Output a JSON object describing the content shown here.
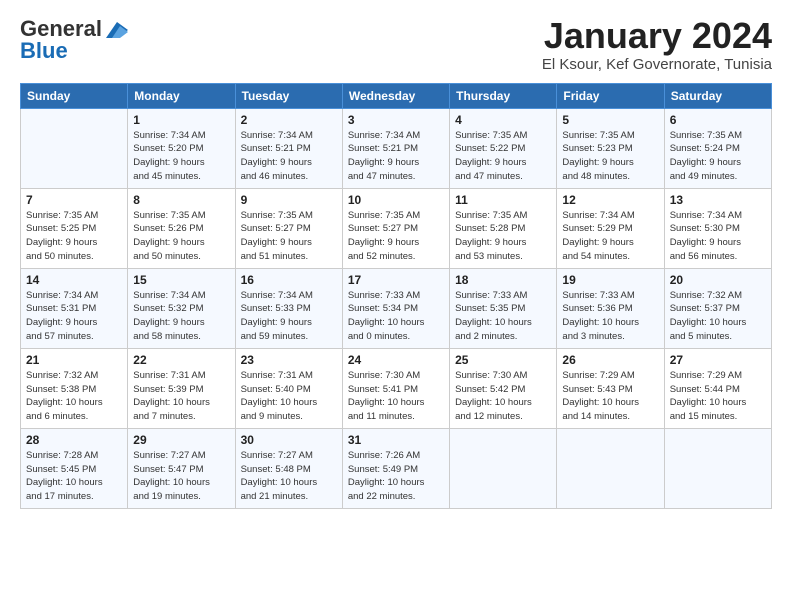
{
  "header": {
    "logo_general": "General",
    "logo_blue": "Blue",
    "month_title": "January 2024",
    "subtitle": "El Ksour, Kef Governorate, Tunisia"
  },
  "days_of_week": [
    "Sunday",
    "Monday",
    "Tuesday",
    "Wednesday",
    "Thursday",
    "Friday",
    "Saturday"
  ],
  "weeks": [
    [
      {
        "day": "",
        "info": ""
      },
      {
        "day": "1",
        "info": "Sunrise: 7:34 AM\nSunset: 5:20 PM\nDaylight: 9 hours\nand 45 minutes."
      },
      {
        "day": "2",
        "info": "Sunrise: 7:34 AM\nSunset: 5:21 PM\nDaylight: 9 hours\nand 46 minutes."
      },
      {
        "day": "3",
        "info": "Sunrise: 7:34 AM\nSunset: 5:21 PM\nDaylight: 9 hours\nand 47 minutes."
      },
      {
        "day": "4",
        "info": "Sunrise: 7:35 AM\nSunset: 5:22 PM\nDaylight: 9 hours\nand 47 minutes."
      },
      {
        "day": "5",
        "info": "Sunrise: 7:35 AM\nSunset: 5:23 PM\nDaylight: 9 hours\nand 48 minutes."
      },
      {
        "day": "6",
        "info": "Sunrise: 7:35 AM\nSunset: 5:24 PM\nDaylight: 9 hours\nand 49 minutes."
      }
    ],
    [
      {
        "day": "7",
        "info": "Sunrise: 7:35 AM\nSunset: 5:25 PM\nDaylight: 9 hours\nand 50 minutes."
      },
      {
        "day": "8",
        "info": "Sunrise: 7:35 AM\nSunset: 5:26 PM\nDaylight: 9 hours\nand 50 minutes."
      },
      {
        "day": "9",
        "info": "Sunrise: 7:35 AM\nSunset: 5:27 PM\nDaylight: 9 hours\nand 51 minutes."
      },
      {
        "day": "10",
        "info": "Sunrise: 7:35 AM\nSunset: 5:27 PM\nDaylight: 9 hours\nand 52 minutes."
      },
      {
        "day": "11",
        "info": "Sunrise: 7:35 AM\nSunset: 5:28 PM\nDaylight: 9 hours\nand 53 minutes."
      },
      {
        "day": "12",
        "info": "Sunrise: 7:34 AM\nSunset: 5:29 PM\nDaylight: 9 hours\nand 54 minutes."
      },
      {
        "day": "13",
        "info": "Sunrise: 7:34 AM\nSunset: 5:30 PM\nDaylight: 9 hours\nand 56 minutes."
      }
    ],
    [
      {
        "day": "14",
        "info": "Sunrise: 7:34 AM\nSunset: 5:31 PM\nDaylight: 9 hours\nand 57 minutes."
      },
      {
        "day": "15",
        "info": "Sunrise: 7:34 AM\nSunset: 5:32 PM\nDaylight: 9 hours\nand 58 minutes."
      },
      {
        "day": "16",
        "info": "Sunrise: 7:34 AM\nSunset: 5:33 PM\nDaylight: 9 hours\nand 59 minutes."
      },
      {
        "day": "17",
        "info": "Sunrise: 7:33 AM\nSunset: 5:34 PM\nDaylight: 10 hours\nand 0 minutes."
      },
      {
        "day": "18",
        "info": "Sunrise: 7:33 AM\nSunset: 5:35 PM\nDaylight: 10 hours\nand 2 minutes."
      },
      {
        "day": "19",
        "info": "Sunrise: 7:33 AM\nSunset: 5:36 PM\nDaylight: 10 hours\nand 3 minutes."
      },
      {
        "day": "20",
        "info": "Sunrise: 7:32 AM\nSunset: 5:37 PM\nDaylight: 10 hours\nand 5 minutes."
      }
    ],
    [
      {
        "day": "21",
        "info": "Sunrise: 7:32 AM\nSunset: 5:38 PM\nDaylight: 10 hours\nand 6 minutes."
      },
      {
        "day": "22",
        "info": "Sunrise: 7:31 AM\nSunset: 5:39 PM\nDaylight: 10 hours\nand 7 minutes."
      },
      {
        "day": "23",
        "info": "Sunrise: 7:31 AM\nSunset: 5:40 PM\nDaylight: 10 hours\nand 9 minutes."
      },
      {
        "day": "24",
        "info": "Sunrise: 7:30 AM\nSunset: 5:41 PM\nDaylight: 10 hours\nand 11 minutes."
      },
      {
        "day": "25",
        "info": "Sunrise: 7:30 AM\nSunset: 5:42 PM\nDaylight: 10 hours\nand 12 minutes."
      },
      {
        "day": "26",
        "info": "Sunrise: 7:29 AM\nSunset: 5:43 PM\nDaylight: 10 hours\nand 14 minutes."
      },
      {
        "day": "27",
        "info": "Sunrise: 7:29 AM\nSunset: 5:44 PM\nDaylight: 10 hours\nand 15 minutes."
      }
    ],
    [
      {
        "day": "28",
        "info": "Sunrise: 7:28 AM\nSunset: 5:45 PM\nDaylight: 10 hours\nand 17 minutes."
      },
      {
        "day": "29",
        "info": "Sunrise: 7:27 AM\nSunset: 5:47 PM\nDaylight: 10 hours\nand 19 minutes."
      },
      {
        "day": "30",
        "info": "Sunrise: 7:27 AM\nSunset: 5:48 PM\nDaylight: 10 hours\nand 21 minutes."
      },
      {
        "day": "31",
        "info": "Sunrise: 7:26 AM\nSunset: 5:49 PM\nDaylight: 10 hours\nand 22 minutes."
      },
      {
        "day": "",
        "info": ""
      },
      {
        "day": "",
        "info": ""
      },
      {
        "day": "",
        "info": ""
      }
    ]
  ]
}
